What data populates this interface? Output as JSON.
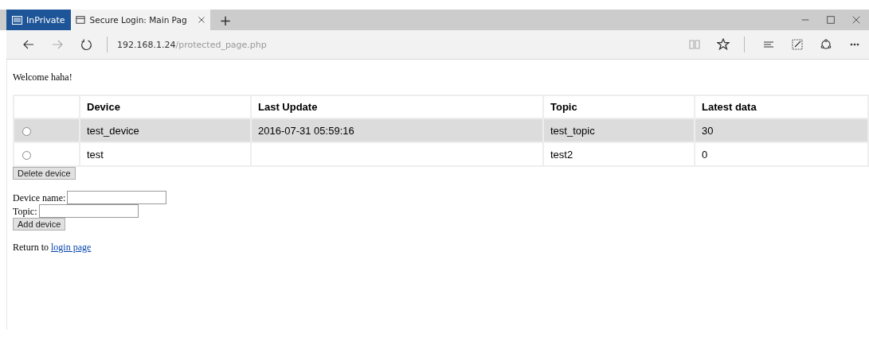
{
  "browser": {
    "private_label": "InPrivate",
    "tab_title": "Secure Login: Main Pag",
    "new_tab": "+",
    "url_host": "192.168.1.24",
    "url_path": "/protected_page.php"
  },
  "page": {
    "welcome": "Welcome haha!",
    "table": {
      "columns": [
        "",
        "Device",
        "Last Update",
        "Topic",
        "Latest data"
      ],
      "rows": [
        {
          "selected": false,
          "highlighted": true,
          "cells": [
            "",
            "test_device",
            "2016-07-31 05:59:16",
            "test_topic",
            "30"
          ]
        },
        {
          "selected": false,
          "highlighted": false,
          "cells": [
            "",
            "test",
            "",
            "test2",
            "0"
          ]
        }
      ]
    },
    "delete_button": "Delete device",
    "form": {
      "fields": [
        {
          "label": "Device name:"
        },
        {
          "label": "Topic:"
        }
      ],
      "button": "Add device"
    },
    "return_text": "Return to",
    "return_link": "login page"
  }
}
